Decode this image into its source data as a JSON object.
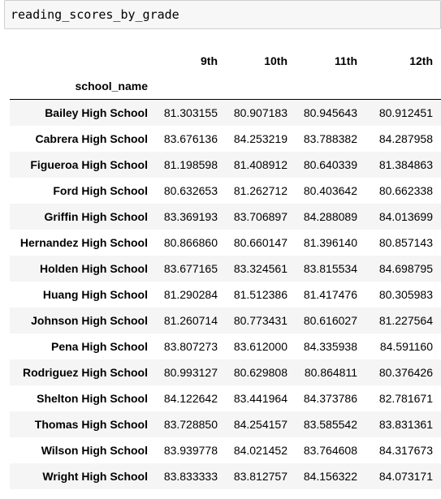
{
  "input_cell": {
    "code": "reading_scores_by_grade"
  },
  "dataframe": {
    "columns": [
      "9th",
      "10th",
      "11th",
      "12th"
    ],
    "index_name": "school_name",
    "rows": [
      {
        "index": "Bailey High School",
        "values": [
          "81.303155",
          "80.907183",
          "80.945643",
          "80.912451"
        ]
      },
      {
        "index": "Cabrera High School",
        "values": [
          "83.676136",
          "84.253219",
          "83.788382",
          "84.287958"
        ]
      },
      {
        "index": "Figueroa High School",
        "values": [
          "81.198598",
          "81.408912",
          "80.640339",
          "81.384863"
        ]
      },
      {
        "index": "Ford High School",
        "values": [
          "80.632653",
          "81.262712",
          "80.403642",
          "80.662338"
        ]
      },
      {
        "index": "Griffin High School",
        "values": [
          "83.369193",
          "83.706897",
          "84.288089",
          "84.013699"
        ]
      },
      {
        "index": "Hernandez High School",
        "values": [
          "80.866860",
          "80.660147",
          "81.396140",
          "80.857143"
        ]
      },
      {
        "index": "Holden High School",
        "values": [
          "83.677165",
          "83.324561",
          "83.815534",
          "84.698795"
        ]
      },
      {
        "index": "Huang High School",
        "values": [
          "81.290284",
          "81.512386",
          "81.417476",
          "80.305983"
        ]
      },
      {
        "index": "Johnson High School",
        "values": [
          "81.260714",
          "80.773431",
          "80.616027",
          "81.227564"
        ]
      },
      {
        "index": "Pena High School",
        "values": [
          "83.807273",
          "83.612000",
          "84.335938",
          "84.591160"
        ]
      },
      {
        "index": "Rodriguez High School",
        "values": [
          "80.993127",
          "80.629808",
          "80.864811",
          "80.376426"
        ]
      },
      {
        "index": "Shelton High School",
        "values": [
          "84.122642",
          "83.441964",
          "84.373786",
          "82.781671"
        ]
      },
      {
        "index": "Thomas High School",
        "values": [
          "83.728850",
          "84.254157",
          "83.585542",
          "83.831361"
        ]
      },
      {
        "index": "Wilson High School",
        "values": [
          "83.939778",
          "84.021452",
          "83.764608",
          "84.317673"
        ]
      },
      {
        "index": "Wright High School",
        "values": [
          "83.833333",
          "83.812757",
          "84.156322",
          "84.073171"
        ]
      }
    ]
  }
}
